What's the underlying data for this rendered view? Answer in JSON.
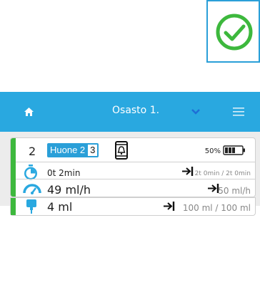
{
  "header": {
    "title": "Osasto 1."
  },
  "card": {
    "bed_number": "2",
    "room_label": "Huone 2",
    "room_number": "3",
    "battery_percent": "50%",
    "time_elapsed": "0t 2min",
    "time_target": "2t 0min / 2t 0min",
    "rate_value": "49 ml/h",
    "rate_target": "50 ml/h",
    "volume_value": "4 ml",
    "volume_target": "100 ml / 100 ml"
  },
  "colors": {
    "brand_blue": "#29a8e0",
    "status_green": "#3db83d",
    "check_green": "#3db83d"
  },
  "icons": [
    "check-circle-icon",
    "home-icon",
    "chevron-down-icon",
    "menu-icon",
    "phone-bell-icon",
    "battery-icon",
    "timer-icon",
    "gauge-icon",
    "iv-bag-icon",
    "arrow-to-bar-icon"
  ]
}
